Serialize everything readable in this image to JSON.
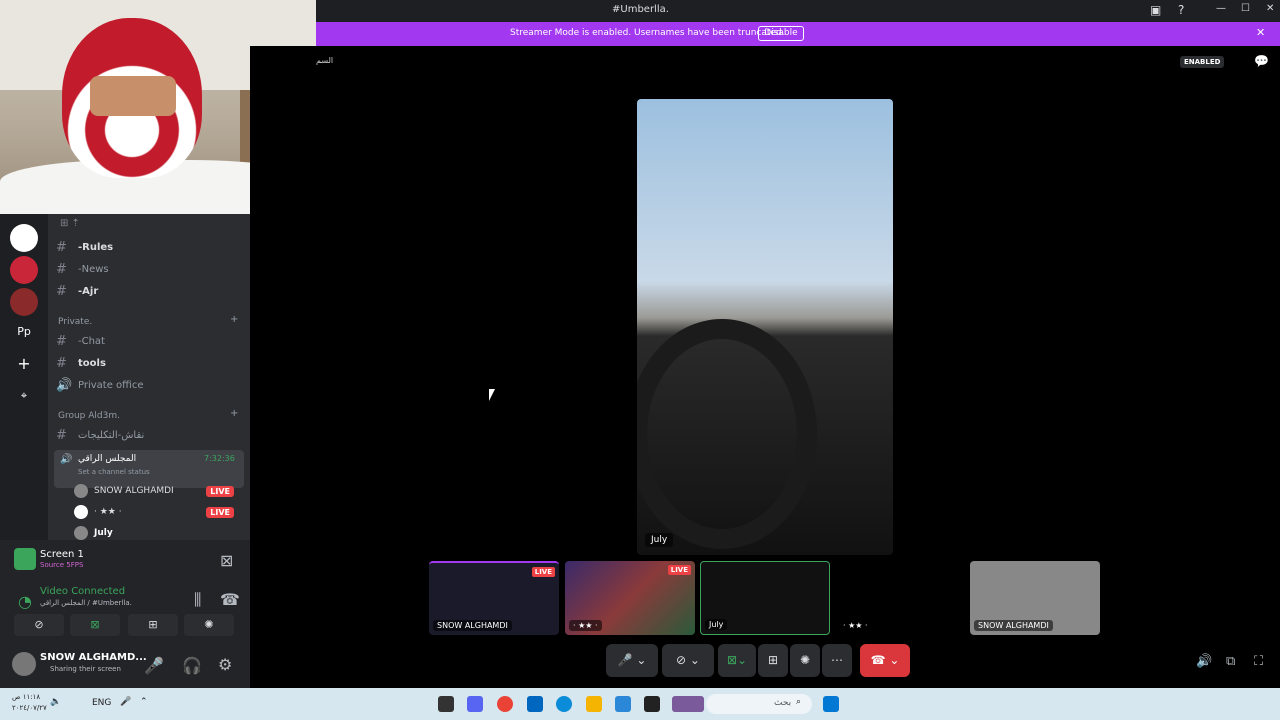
{
  "titlebar": {
    "title": "#Umberlla."
  },
  "banner": {
    "text": "Streamer Mode is enabled. Usernames have been truncated.",
    "button": "Disable"
  },
  "stage_header": {
    "small_label": "السم",
    "enabled": "ENABLED"
  },
  "servers": [
    {
      "label": ""
    },
    {
      "label": ""
    },
    {
      "label": ""
    },
    {
      "label": "Pp"
    },
    {
      "label": "+"
    },
    {
      "label": "⌖"
    }
  ],
  "channels": {
    "top_icon_row": "⊞ ⇡",
    "items": [
      {
        "icon": "#",
        "name": "Rules",
        "prefix": "- "
      },
      {
        "icon": "#",
        "name": "News",
        "prefix": "- "
      },
      {
        "icon": "#",
        "name": "Ajr",
        "prefix": "- "
      }
    ],
    "category_private": "Private.",
    "private_items": [
      {
        "icon": "#",
        "name": "Chat",
        "prefix": "- "
      },
      {
        "icon": "#",
        "name": "tools",
        "prefix": ""
      },
      {
        "icon": "🔊",
        "name": "Private office",
        "prefix": ""
      }
    ],
    "category_group": "Group Ald3m.",
    "group_text_channel": "نقاش-التكليجات",
    "voice_channel": {
      "name": "المجلس الراقي",
      "timer": "7:32:36",
      "status": "Set a channel status"
    },
    "users": [
      {
        "name": "SNOW ALGHAMDI",
        "live": "LIVE"
      },
      {
        "name": "· ★★ ·",
        "live": "LIVE"
      },
      {
        "name": "July",
        "live": ""
      }
    ]
  },
  "panel": {
    "screen_title": "Screen 1",
    "screen_sub": "Source 5FPS",
    "video_status": "Video Connected",
    "video_channel": "المجلس الراقي / #Umberlla.",
    "user_name": "SNOW ALGHAMD...",
    "user_status": "Sharing their screen"
  },
  "stage": {
    "main_label": "July",
    "tiles": [
      {
        "label": "SNOW ALGHAMDI",
        "badge": "LIVE"
      },
      {
        "label": "· ★★ ·",
        "badge": "LIVE"
      },
      {
        "label": "July",
        "badge": ""
      },
      {
        "label": "· ★★ ·",
        "badge": ""
      },
      {
        "label": "SNOW ALGHAMDI",
        "badge": ""
      }
    ]
  },
  "taskbar": {
    "time": "١١:١٨ ص",
    "date": "٢٠٢٤/٠٧/٢٧",
    "lang": "ENG",
    "search_placeholder": "بحث"
  },
  "colors": {
    "accent": "#a239f0",
    "live": "#ed4245",
    "green": "#3ba55c"
  }
}
